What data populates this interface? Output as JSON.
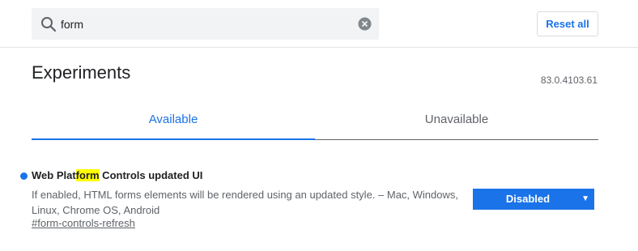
{
  "search": {
    "value": "form"
  },
  "header": {
    "reset_label": "Reset all"
  },
  "main": {
    "title": "Experiments",
    "version": "83.0.4103.61",
    "tabs": [
      {
        "label": "Available"
      },
      {
        "label": "Unavailable"
      }
    ]
  },
  "experiment": {
    "title_before": "Web Plat",
    "title_highlight": "form",
    "title_after": " Controls updated UI",
    "description": "If enabled, HTML forms elements will be rendered using an updated style. – Mac, Windows, Linux, Chrome OS, Android",
    "link": "#form-controls-refresh",
    "select_value": "Disabled",
    "select_arrow": "▼"
  },
  "colors": {
    "accent": "#1a73e8",
    "highlight": "#ffff00",
    "status_dot": "#1a73e8"
  },
  "icons": {
    "search": "search-icon",
    "clear": "clear-icon"
  }
}
